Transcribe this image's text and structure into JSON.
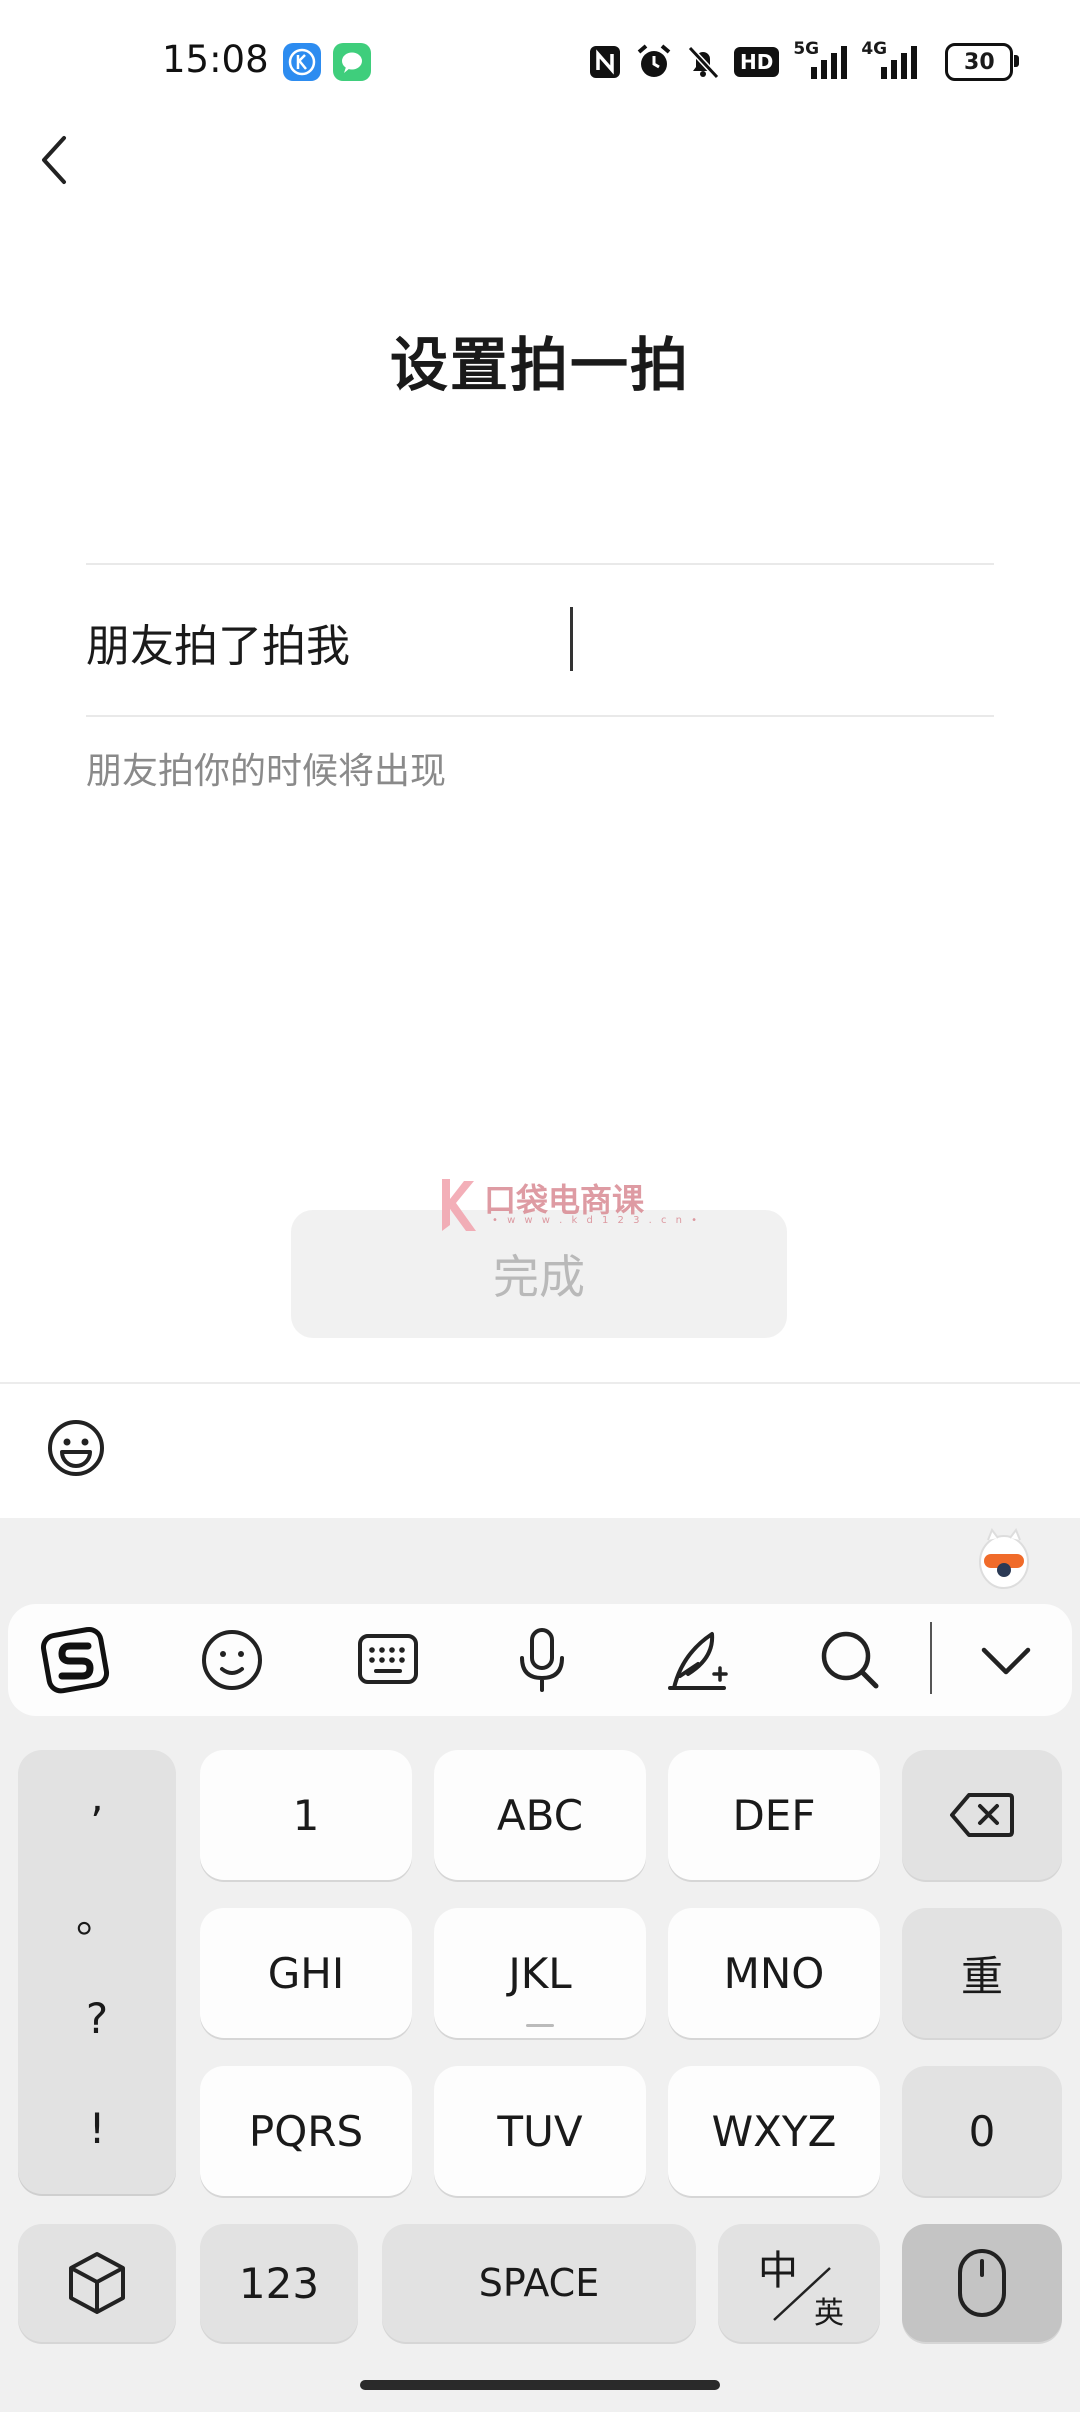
{
  "status_bar": {
    "time": "15:08",
    "app_icons": [
      "k-app-icon",
      "message-app-icon"
    ],
    "icons": [
      "nfc-icon",
      "alarm-icon",
      "mute-bell-icon",
      "hd-icon",
      "signal-5g-icon",
      "signal-4g-icon"
    ],
    "hd_label": "HD",
    "net1": "5G",
    "net2": "4G",
    "battery": "30"
  },
  "page": {
    "title": "设置拍一拍",
    "input_value": "朋友拍了拍我",
    "hint": "朋友拍你的时候将出现",
    "done_label": "完成"
  },
  "watermark": {
    "text": "口袋电商课",
    "url": "• w w w . k d 1 2 3 . c n •"
  },
  "keyboard": {
    "toolbar_icons": [
      "sogou-logo-icon",
      "emoji-icon",
      "keyboard-icon",
      "microphone-icon",
      "handwriting-icon",
      "search-icon",
      "collapse-chevron-icon"
    ],
    "punctuation": [
      ",",
      "。",
      "?",
      "!"
    ],
    "rows": [
      [
        "1",
        "ABC",
        "DEF"
      ],
      [
        "GHI",
        "JKL",
        "MNO"
      ],
      [
        "PQRS",
        "TUV",
        "WXYZ"
      ]
    ],
    "side_keys": {
      "redo": "重",
      "zero": "0"
    },
    "bottom": {
      "numbers": "123",
      "space": "SPACE",
      "lang_top": "中",
      "lang_bottom": "英"
    }
  },
  "colors": {
    "done_bg": "#f1f1f1",
    "done_text": "#b9b9b9",
    "keyboard_bg": "#f0f0f0",
    "key_bg": "#fdfdfd",
    "func_key_bg": "#e2e2e2"
  }
}
